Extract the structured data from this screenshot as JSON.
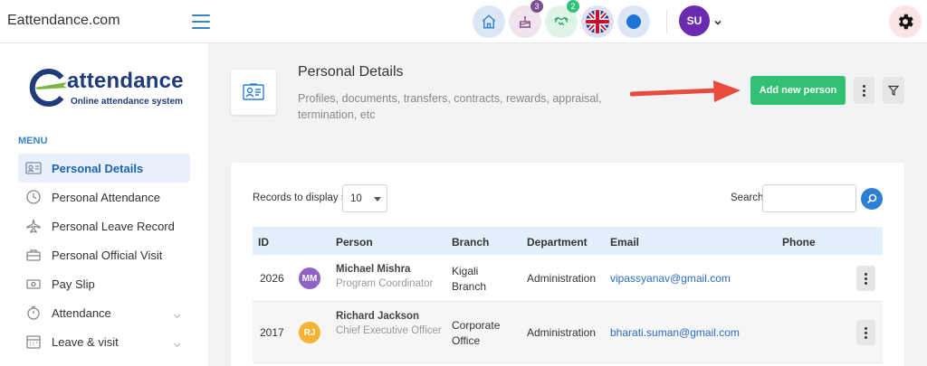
{
  "app": {
    "brand": "Eattendance.com"
  },
  "topbar": {
    "icons": [
      "home-icon",
      "cake-icon",
      "handshake-icon",
      "uk-flag-icon",
      "status-dot-icon",
      "gear-icon"
    ],
    "cake_badge": "3",
    "handshake_badge": "2",
    "user_initials": "SU"
  },
  "logo": {
    "title": "attendance",
    "subtitle": "Online attendance system"
  },
  "sidebar": {
    "menu_heading": "MENU",
    "items": [
      {
        "label": "Personal Details",
        "icon": "id-card-icon",
        "active": true
      },
      {
        "label": "Personal Attendance",
        "icon": "clock-icon"
      },
      {
        "label": "Personal Leave Record",
        "icon": "airplane-icon"
      },
      {
        "label": "Personal Official Visit",
        "icon": "briefcase-icon"
      },
      {
        "label": "Pay Slip",
        "icon": "money-icon"
      },
      {
        "label": "Attendance",
        "icon": "stopwatch-icon",
        "expandable": true
      },
      {
        "label": "Leave & visit",
        "icon": "calendar-icon",
        "expandable": true
      }
    ]
  },
  "header": {
    "title": "Personal Details",
    "subtitle": "Profiles, documents, transfers, contracts, rewards, appraisal, termination, etc",
    "add_button": "Add new person"
  },
  "table_controls": {
    "records_label": "Records to display »",
    "records_value": "10",
    "search_label": "Search",
    "search_value": ""
  },
  "table": {
    "columns": [
      "ID",
      "Person",
      "Branch",
      "Department",
      "Email",
      "Phone"
    ],
    "rows": [
      {
        "id": "2026",
        "initials": "MM",
        "avatar_color": "#8e62c6",
        "name": "Michael Mishra",
        "role": "Program Coordinator",
        "branch": "Kigali Branch",
        "department": "Administration",
        "email": "vipassyanav@gmail.com",
        "phone": ""
      },
      {
        "id": "2017",
        "initials": "RJ",
        "avatar_color": "#f5b335",
        "name": "Richard Jackson",
        "role": "Chief Executive Officer",
        "branch": "Corporate Office",
        "department": "Administration",
        "email": "bharati.suman@gmail.com",
        "phone": ""
      }
    ]
  },
  "colors": {
    "accent": "#2b7fd6",
    "add_button": "#32c074",
    "active_nav": "#1c64b5",
    "arrow": "#e94b3c"
  }
}
